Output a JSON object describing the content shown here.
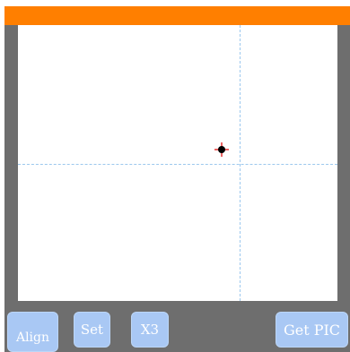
{
  "colors": {
    "top_bar": "#ff7f00",
    "frame": "#6e6e6e",
    "button": "#a9c8f4",
    "crosshair": "#9cc8ee",
    "marker": "#000000",
    "marker_cross": "#e53030"
  },
  "toolbar": {
    "align_label": "Align",
    "set_label": "Set",
    "x3_label": "X3",
    "get_pic_label": "Get PIC"
  }
}
